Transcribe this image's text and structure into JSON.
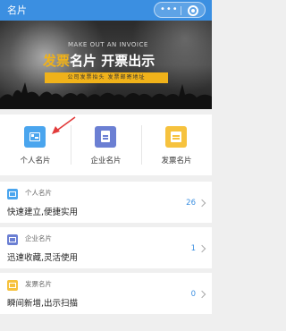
{
  "header": {
    "title": "名片"
  },
  "banner": {
    "subtitle": "MAKE OUT AN INVOICE",
    "main_highlight": "发票",
    "main_rest": "名片 开票出示",
    "tagline": "公司发票抬头 发票邮寄地址"
  },
  "quick_actions": [
    {
      "label": "个人名片",
      "icon": "id-card-icon",
      "color": "#4aa5ee"
    },
    {
      "label": "企业名片",
      "icon": "document-icon",
      "color": "#6b7fd3"
    },
    {
      "label": "发票名片",
      "icon": "invoice-icon",
      "color": "#f6c23e"
    }
  ],
  "cards": [
    {
      "title": "个人名片",
      "description": "快速建立,便捷实用",
      "count": "26",
      "color": "#4aa5ee"
    },
    {
      "title": "企业名片",
      "description": "迅速收藏,灵活使用",
      "count": "1",
      "color": "#6b7fd3"
    },
    {
      "title": "发票名片",
      "description": "瞬间新增,出示扫描",
      "count": "0",
      "color": "#f6c23e"
    }
  ],
  "colors": {
    "primary": "#3b8fe1",
    "accent": "#f0b21a",
    "pointer_arrow": "#e23b3b"
  }
}
